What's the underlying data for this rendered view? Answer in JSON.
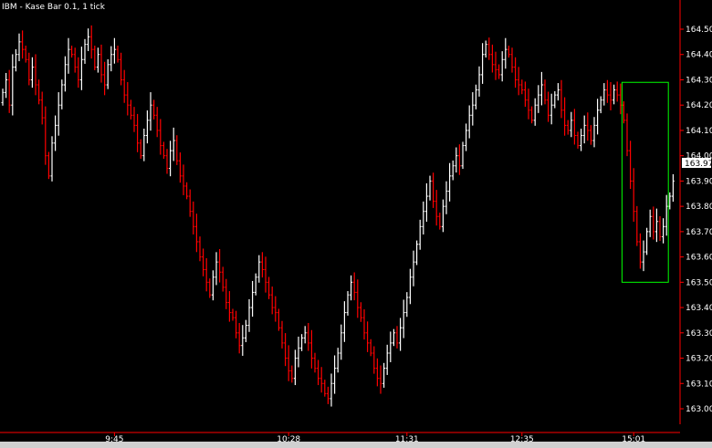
{
  "chart_data": {
    "type": "ohlc",
    "title": "IBM - Kase Bar 0.1, 1 tick",
    "xlabel": "",
    "ylabel": "",
    "ylim": [
      162.95,
      164.55
    ],
    "y_ticks": [
      163.0,
      163.1,
      163.2,
      163.3,
      163.4,
      163.5,
      163.6,
      163.7,
      163.8,
      163.9,
      164.0,
      164.1,
      164.2,
      164.3,
      164.4,
      164.5
    ],
    "y_tick_labels": [
      "163.00",
      "163.10",
      "163.20",
      "163.30",
      "163.40",
      "163.50",
      "163.60",
      "163.70",
      "163.80",
      "163.90",
      "164.00",
      "164.10",
      "164.20",
      "164.30",
      "164.40",
      "164.50"
    ],
    "x_ticks": [
      {
        "label": "9:45",
        "bar": 34
      },
      {
        "label": "10:28",
        "bar": 87
      },
      {
        "label": "11:31",
        "bar": 123
      },
      {
        "label": "12:35",
        "bar": 158
      },
      {
        "label": "15:01",
        "bar": 192
      }
    ],
    "last_price": "163.97",
    "bar_colors": {
      "up": "#ffffff",
      "down": "#ff0000"
    },
    "grid": false,
    "highlight_box": {
      "bar_start": 189,
      "bar_end": 202,
      "y_low": 163.5,
      "y_high": 164.29,
      "color": "#00ff00"
    },
    "closes": [
      164.25,
      164.3,
      164.2,
      164.35,
      164.4,
      164.45,
      164.42,
      164.38,
      164.3,
      164.35,
      164.28,
      164.22,
      164.15,
      164.0,
      163.92,
      164.05,
      164.12,
      164.2,
      164.28,
      164.36,
      164.42,
      164.4,
      164.35,
      164.3,
      164.38,
      164.44,
      164.47,
      164.42,
      164.35,
      164.4,
      164.32,
      164.28,
      164.36,
      164.4,
      164.42,
      164.38,
      164.3,
      164.24,
      164.2,
      164.16,
      164.12,
      164.05,
      164.0,
      164.08,
      164.14,
      164.2,
      164.16,
      164.1,
      164.04,
      164.0,
      163.95,
      164.02,
      164.06,
      163.98,
      163.92,
      163.88,
      163.84,
      163.78,
      163.72,
      163.66,
      163.6,
      163.55,
      163.5,
      163.45,
      163.52,
      163.58,
      163.54,
      163.48,
      163.42,
      163.38,
      163.36,
      163.3,
      163.25,
      163.28,
      163.33,
      163.4,
      163.46,
      163.52,
      163.58,
      163.55,
      163.5,
      163.45,
      163.4,
      163.38,
      163.32,
      163.26,
      163.2,
      163.15,
      163.12,
      163.2,
      163.24,
      163.28,
      163.3,
      163.26,
      163.2,
      163.16,
      163.12,
      163.1,
      163.06,
      163.04,
      163.1,
      163.16,
      163.22,
      163.3,
      163.38,
      163.45,
      163.5,
      163.46,
      163.4,
      163.36,
      163.3,
      163.26,
      163.22,
      163.16,
      163.12,
      163.1,
      163.16,
      163.22,
      163.26,
      163.3,
      163.26,
      163.32,
      163.38,
      163.44,
      163.52,
      163.58,
      163.65,
      163.72,
      163.78,
      163.84,
      163.9,
      163.82,
      163.76,
      163.72,
      163.8,
      163.86,
      163.92,
      163.96,
      164.0,
      163.96,
      164.04,
      164.1,
      164.16,
      164.2,
      164.26,
      164.32,
      164.4,
      164.44,
      164.4,
      164.36,
      164.34,
      164.32,
      164.38,
      164.42,
      164.4,
      164.35,
      164.3,
      164.28,
      164.26,
      164.22,
      164.18,
      164.14,
      164.2,
      164.24,
      164.28,
      164.22,
      164.16,
      164.2,
      164.24,
      164.26,
      164.18,
      164.12,
      164.1,
      164.14,
      164.08,
      164.04,
      164.08,
      164.12,
      164.1,
      164.06,
      164.12,
      164.18,
      164.22,
      164.26,
      164.24,
      164.22,
      164.26,
      164.24,
      164.2,
      164.14,
      164.02,
      163.9,
      163.78,
      163.66,
      163.58,
      163.62,
      163.7,
      163.76,
      163.7,
      163.74,
      163.68,
      163.72,
      163.8,
      163.84,
      163.9
    ]
  }
}
